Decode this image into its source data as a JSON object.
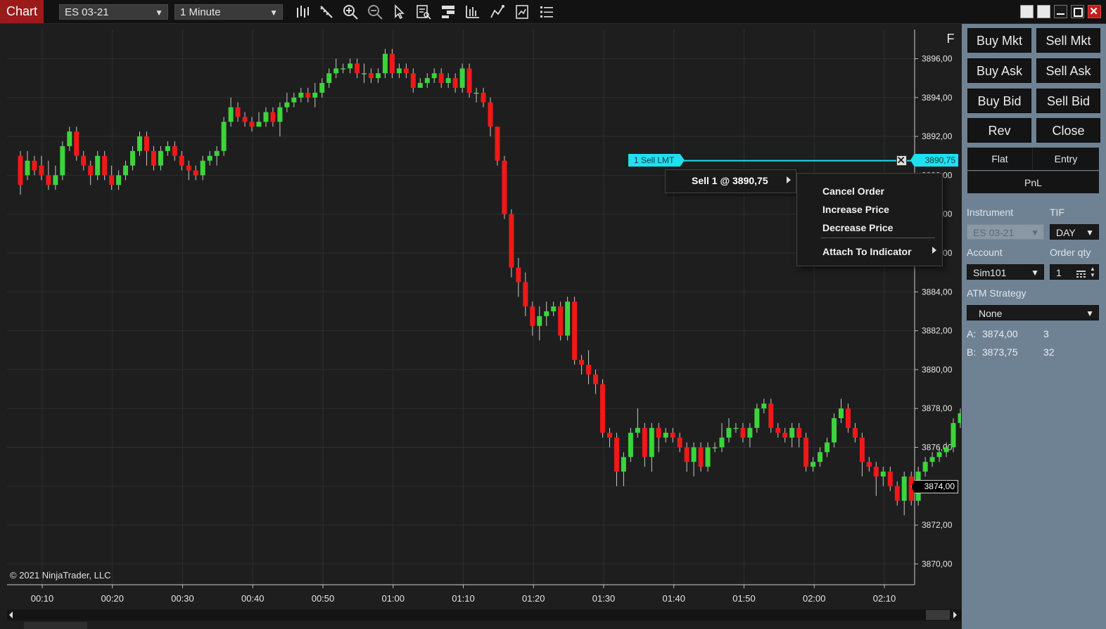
{
  "toolbar": {
    "tab_label": "Chart",
    "instrument": "ES 03-21",
    "interval": "1 Minute",
    "icons": [
      "bar-type-icon",
      "drawing-tool-icon",
      "zoom-in-icon",
      "zoom-out-icon",
      "pointer-icon",
      "data-box-icon",
      "chart-trader-icon",
      "indicators-icon",
      "strategies-icon",
      "templates-icon",
      "properties-icon"
    ]
  },
  "chart": {
    "copyright": "© 2021 NinjaTrader, LLC",
    "f_button": "F",
    "price_axis": [
      "3896,00",
      "3894,00",
      "3892,00",
      "3890,00",
      "3888,00",
      "3886,00",
      "3884,00",
      "3882,00",
      "3880,00",
      "3878,00",
      "3876,00",
      "3874,00",
      "3872,00",
      "3870,00"
    ],
    "time_axis": [
      "00:10",
      "00:20",
      "00:30",
      "00:40",
      "00:50",
      "01:00",
      "01:10",
      "01:20",
      "01:30",
      "01:40",
      "01:50",
      "02:00",
      "02:10"
    ],
    "order_line": {
      "label": "1  Sell LMT",
      "price": "3890,75"
    },
    "last_price": "3874,00",
    "colors": {
      "up": "#3bd43b",
      "down": "#f01818",
      "order_line": "#1ee0ee",
      "background": "#1e1e1e"
    }
  },
  "context_menu": {
    "main_item": "Sell 1 @ 3890,75",
    "sub_items": [
      "Cancel Order",
      "Increase Price",
      "Decrease Price",
      "Attach To Indicator"
    ]
  },
  "order_panel": {
    "buttons": {
      "buy_mkt": "Buy Mkt",
      "sell_mkt": "Sell Mkt",
      "buy_ask": "Buy Ask",
      "sell_ask": "Sell Ask",
      "buy_bid": "Buy Bid",
      "sell_bid": "Sell Bid",
      "rev": "Rev",
      "close": "Close"
    },
    "position": {
      "flat": "Flat",
      "entry": "Entry",
      "pnl": "PnL"
    },
    "instrument_label": "Instrument",
    "instrument_value": "ES 03-21",
    "tif_label": "TIF",
    "tif_value": "DAY",
    "account_label": "Account",
    "account_value": "Sim101",
    "qty_label": "Order qty",
    "qty_value": "1",
    "atm_label": "ATM Strategy",
    "atm_value": "None",
    "ask_label": "A:",
    "ask_price": "3874,00",
    "ask_size": "3",
    "bid_label": "B:",
    "bid_price": "3873,75",
    "bid_size": "32"
  },
  "chart_data": {
    "type": "candlestick",
    "instrument": "ES 03-21",
    "interval": "1 Minute",
    "candles": [
      [
        3891.0,
        3889.5,
        3891.25,
        3889.0
      ],
      [
        3890.0,
        3890.75,
        3891.25,
        3889.75
      ],
      [
        3890.75,
        3890.25,
        3891.0,
        3890.0
      ],
      [
        3890.5,
        3890.0,
        3891.0,
        3889.75
      ],
      [
        3890.0,
        3889.5,
        3890.75,
        3889.25
      ],
      [
        3889.5,
        3890.0,
        3890.5,
        3889.25
      ],
      [
        3890.0,
        3891.5,
        3891.75,
        3889.75
      ],
      [
        3891.5,
        3892.25,
        3892.5,
        3891.25
      ],
      [
        3892.25,
        3891.0,
        3892.5,
        3890.75
      ],
      [
        3891.0,
        3890.5,
        3891.25,
        3890.25
      ],
      [
        3890.5,
        3890.0,
        3890.75,
        3889.5
      ],
      [
        3890.0,
        3891.0,
        3891.25,
        3889.75
      ],
      [
        3891.0,
        3890.0,
        3891.25,
        3889.75
      ],
      [
        3890.0,
        3889.5,
        3890.5,
        3889.25
      ],
      [
        3889.5,
        3890.0,
        3890.25,
        3889.25
      ],
      [
        3890.0,
        3890.5,
        3890.75,
        3889.75
      ],
      [
        3890.5,
        3891.25,
        3891.5,
        3890.25
      ],
      [
        3891.25,
        3892.0,
        3892.25,
        3891.0
      ],
      [
        3892.0,
        3891.25,
        3892.25,
        3890.5
      ],
      [
        3891.25,
        3890.5,
        3891.5,
        3890.25
      ],
      [
        3890.5,
        3891.25,
        3891.5,
        3890.25
      ],
      [
        3891.25,
        3891.5,
        3891.75,
        3891.0
      ],
      [
        3891.5,
        3891.0,
        3891.75,
        3890.75
      ],
      [
        3891.0,
        3890.5,
        3891.25,
        3890.25
      ],
      [
        3890.5,
        3890.25,
        3890.75,
        3889.75
      ],
      [
        3890.25,
        3890.0,
        3890.5,
        3889.75
      ],
      [
        3890.0,
        3890.75,
        3891.0,
        3889.75
      ],
      [
        3890.75,
        3891.0,
        3891.25,
        3890.5
      ],
      [
        3891.0,
        3891.25,
        3891.5,
        3890.5
      ],
      [
        3891.25,
        3892.75,
        3893.0,
        3891.0
      ],
      [
        3892.75,
        3893.5,
        3894.0,
        3892.5
      ],
      [
        3893.5,
        3893.0,
        3893.75,
        3892.75
      ],
      [
        3893.0,
        3892.75,
        3893.25,
        3892.5
      ],
      [
        3892.75,
        3892.5,
        3893.0,
        3892.25
      ],
      [
        3892.5,
        3892.75,
        3893.25,
        3892.5
      ],
      [
        3892.75,
        3893.25,
        3893.5,
        3892.5
      ],
      [
        3893.25,
        3892.75,
        3893.5,
        3892.5
      ],
      [
        3892.75,
        3893.5,
        3893.75,
        3892.0
      ],
      [
        3893.5,
        3893.75,
        3894.25,
        3893.25
      ],
      [
        3893.75,
        3894.0,
        3894.25,
        3893.5
      ],
      [
        3894.0,
        3894.25,
        3894.5,
        3893.75
      ],
      [
        3894.25,
        3894.0,
        3894.5,
        3893.75
      ],
      [
        3894.0,
        3894.25,
        3894.75,
        3893.5
      ],
      [
        3894.25,
        3894.75,
        3895.0,
        3894.0
      ],
      [
        3894.75,
        3895.25,
        3895.5,
        3894.5
      ],
      [
        3895.25,
        3895.5,
        3896.0,
        3895.0
      ],
      [
        3895.5,
        3895.5,
        3895.75,
        3895.25
      ],
      [
        3895.5,
        3895.75,
        3896.0,
        3895.25
      ],
      [
        3895.75,
        3895.25,
        3896.0,
        3895.0
      ],
      [
        3895.25,
        3895.25,
        3895.75,
        3894.75
      ],
      [
        3895.25,
        3895.0,
        3895.5,
        3894.75
      ],
      [
        3895.0,
        3895.25,
        3895.5,
        3894.75
      ],
      [
        3895.25,
        3896.25,
        3896.5,
        3895.0
      ],
      [
        3896.25,
        3895.25,
        3896.5,
        3895.0
      ],
      [
        3895.25,
        3895.5,
        3895.75,
        3895.0
      ],
      [
        3895.5,
        3895.25,
        3895.75,
        3895.0
      ],
      [
        3895.25,
        3894.5,
        3895.5,
        3894.25
      ],
      [
        3894.5,
        3894.75,
        3895.0,
        3894.5
      ],
      [
        3894.75,
        3895.0,
        3895.25,
        3894.5
      ],
      [
        3895.0,
        3895.25,
        3895.5,
        3894.75
      ],
      [
        3895.25,
        3894.75,
        3895.5,
        3894.5
      ],
      [
        3894.75,
        3895.0,
        3895.25,
        3894.5
      ],
      [
        3895.0,
        3894.5,
        3895.25,
        3894.25
      ],
      [
        3894.5,
        3895.5,
        3895.75,
        3894.25
      ],
      [
        3895.5,
        3894.25,
        3895.75,
        3894.0
      ],
      [
        3894.25,
        3894.25,
        3894.5,
        3893.75
      ],
      [
        3894.25,
        3893.75,
        3894.5,
        3893.5
      ],
      [
        3893.75,
        3892.5,
        3894.0,
        3892.0
      ],
      [
        3892.5,
        3890.75,
        3892.5,
        3890.5
      ],
      [
        3890.75,
        3888.0,
        3891.0,
        3887.75
      ],
      [
        3888.0,
        3885.25,
        3888.25,
        3884.75
      ],
      [
        3885.25,
        3884.5,
        3885.75,
        3883.75
      ],
      [
        3884.5,
        3883.25,
        3885.0,
        3882.75
      ],
      [
        3883.25,
        3882.25,
        3883.5,
        3881.75
      ],
      [
        3882.25,
        3882.75,
        3883.25,
        3881.5
      ],
      [
        3882.75,
        3883.0,
        3883.5,
        3882.25
      ],
      [
        3883.0,
        3883.25,
        3883.5,
        3882.75
      ],
      [
        3883.25,
        3881.75,
        3883.5,
        3881.5
      ],
      [
        3881.75,
        3883.5,
        3883.75,
        3881.5
      ],
      [
        3883.5,
        3880.5,
        3883.75,
        3880.25
      ],
      [
        3880.5,
        3880.25,
        3880.75,
        3879.75
      ],
      [
        3880.25,
        3879.75,
        3881.0,
        3879.25
      ],
      [
        3879.75,
        3879.25,
        3880.0,
        3878.75
      ],
      [
        3879.25,
        3876.75,
        3879.5,
        3876.5
      ],
      [
        3876.75,
        3876.5,
        3877.0,
        3876.0
      ],
      [
        3876.5,
        3874.75,
        3876.75,
        3874.0
      ],
      [
        3874.75,
        3875.5,
        3875.75,
        3874.0
      ],
      [
        3875.5,
        3876.75,
        3877.0,
        3875.25
      ],
      [
        3876.75,
        3877.0,
        3878.0,
        3876.5
      ],
      [
        3877.0,
        3875.5,
        3877.25,
        3875.0
      ],
      [
        3875.5,
        3877.0,
        3877.25,
        3874.75
      ],
      [
        3877.0,
        3876.5,
        3877.25,
        3875.75
      ],
      [
        3876.5,
        3876.75,
        3877.0,
        3876.25
      ],
      [
        3876.75,
        3876.5,
        3877.0,
        3876.25
      ],
      [
        3876.5,
        3876.0,
        3876.75,
        3875.75
      ],
      [
        3876.0,
        3875.25,
        3876.25,
        3874.75
      ],
      [
        3875.25,
        3876.0,
        3876.25,
        3874.5
      ],
      [
        3876.0,
        3875.0,
        3876.25,
        3874.75
      ],
      [
        3875.0,
        3876.0,
        3876.25,
        3874.75
      ],
      [
        3876.0,
        3876.0,
        3876.25,
        3875.75
      ],
      [
        3876.0,
        3876.5,
        3877.25,
        3875.75
      ],
      [
        3876.5,
        3877.0,
        3877.5,
        3876.25
      ],
      [
        3877.0,
        3877.0,
        3877.25,
        3876.75
      ],
      [
        3877.0,
        3876.5,
        3877.25,
        3876.25
      ],
      [
        3876.5,
        3877.0,
        3877.25,
        3876.0
      ],
      [
        3877.0,
        3878.0,
        3878.25,
        3876.75
      ],
      [
        3878.0,
        3878.25,
        3878.5,
        3877.75
      ],
      [
        3878.25,
        3877.0,
        3878.5,
        3876.75
      ],
      [
        3877.0,
        3876.75,
        3877.25,
        3876.5
      ],
      [
        3876.75,
        3876.5,
        3877.0,
        3876.25
      ],
      [
        3876.5,
        3877.0,
        3877.25,
        3876.0
      ],
      [
        3877.0,
        3876.5,
        3877.25,
        3876.0
      ],
      [
        3876.5,
        3875.0,
        3876.75,
        3874.75
      ],
      [
        3875.0,
        3875.25,
        3875.5,
        3874.75
      ],
      [
        3875.25,
        3875.75,
        3876.0,
        3875.0
      ],
      [
        3875.75,
        3876.25,
        3876.5,
        3875.5
      ],
      [
        3876.25,
        3877.5,
        3877.75,
        3876.0
      ],
      [
        3877.5,
        3878.0,
        3878.5,
        3877.25
      ],
      [
        3878.0,
        3877.0,
        3878.25,
        3876.75
      ],
      [
        3877.0,
        3876.5,
        3877.25,
        3876.25
      ],
      [
        3876.5,
        3875.25,
        3876.75,
        3874.5
      ],
      [
        3875.25,
        3875.0,
        3875.5,
        3874.75
      ],
      [
        3875.0,
        3874.5,
        3875.25,
        3873.5
      ],
      [
        3874.5,
        3874.75,
        3875.0,
        3874.0
      ],
      [
        3874.75,
        3874.0,
        3875.0,
        3873.75
      ],
      [
        3874.0,
        3873.25,
        3874.25,
        3873.0
      ],
      [
        3873.25,
        3874.5,
        3874.75,
        3872.5
      ],
      [
        3874.5,
        3873.25,
        3874.75,
        3873.0
      ],
      [
        3873.25,
        3874.75,
        3875.0,
        3873.0
      ],
      [
        3874.75,
        3875.25,
        3875.5,
        3874.5
      ],
      [
        3875.25,
        3875.5,
        3875.75,
        3875.0
      ],
      [
        3875.5,
        3875.75,
        3876.0,
        3875.25
      ],
      [
        3875.75,
        3876.0,
        3876.25,
        3875.5
      ],
      [
        3876.0,
        3877.25,
        3877.5,
        3875.75
      ],
      [
        3877.25,
        3877.75,
        3878.0,
        3877.0
      ],
      [
        3877.75,
        3877.25,
        3878.0,
        3877.0
      ],
      [
        3877.25,
        3877.75,
        3878.0,
        3877.0
      ],
      [
        3877.75,
        3877.0,
        3878.0,
        3876.75
      ],
      [
        3877.0,
        3875.0,
        3877.25,
        3874.5
      ],
      [
        3875.0,
        3874.0,
        3875.25,
        3873.5
      ],
      [
        3874.0,
        3873.5,
        3874.25,
        3872.5
      ],
      [
        3873.5,
        3872.5,
        3873.75,
        3872.25
      ],
      [
        3872.5,
        3871.5,
        3872.75,
        3871.0
      ],
      [
        3871.5,
        3873.25,
        3873.5,
        3871.25
      ],
      [
        3873.25,
        3872.5,
        3873.5,
        3872.0
      ],
      [
        3872.5,
        3873.5,
        3873.75,
        3872.25
      ],
      [
        3873.5,
        3873.25,
        3873.75,
        3872.5
      ],
      [
        3873.25,
        3874.0,
        3874.25,
        3872.75
      ],
      [
        3874.0,
        3875.75,
        3876.0,
        3873.75
      ],
      [
        3875.75,
        3876.5,
        3876.75,
        3875.5
      ],
      [
        3876.5,
        3876.25,
        3876.75,
        3876.0
      ],
      [
        3876.25,
        3878.25,
        3878.5,
        3876.0
      ],
      [
        3878.25,
        3876.5,
        3878.5,
        3876.25
      ],
      [
        3876.5,
        3875.5,
        3876.75,
        3875.25
      ],
      [
        3875.5,
        3874.25,
        3875.75,
        3874.0
      ]
    ],
    "order_price": 3890.75,
    "last_price": 3874.0,
    "ylim": [
      3869.25,
      3896.75
    ]
  }
}
